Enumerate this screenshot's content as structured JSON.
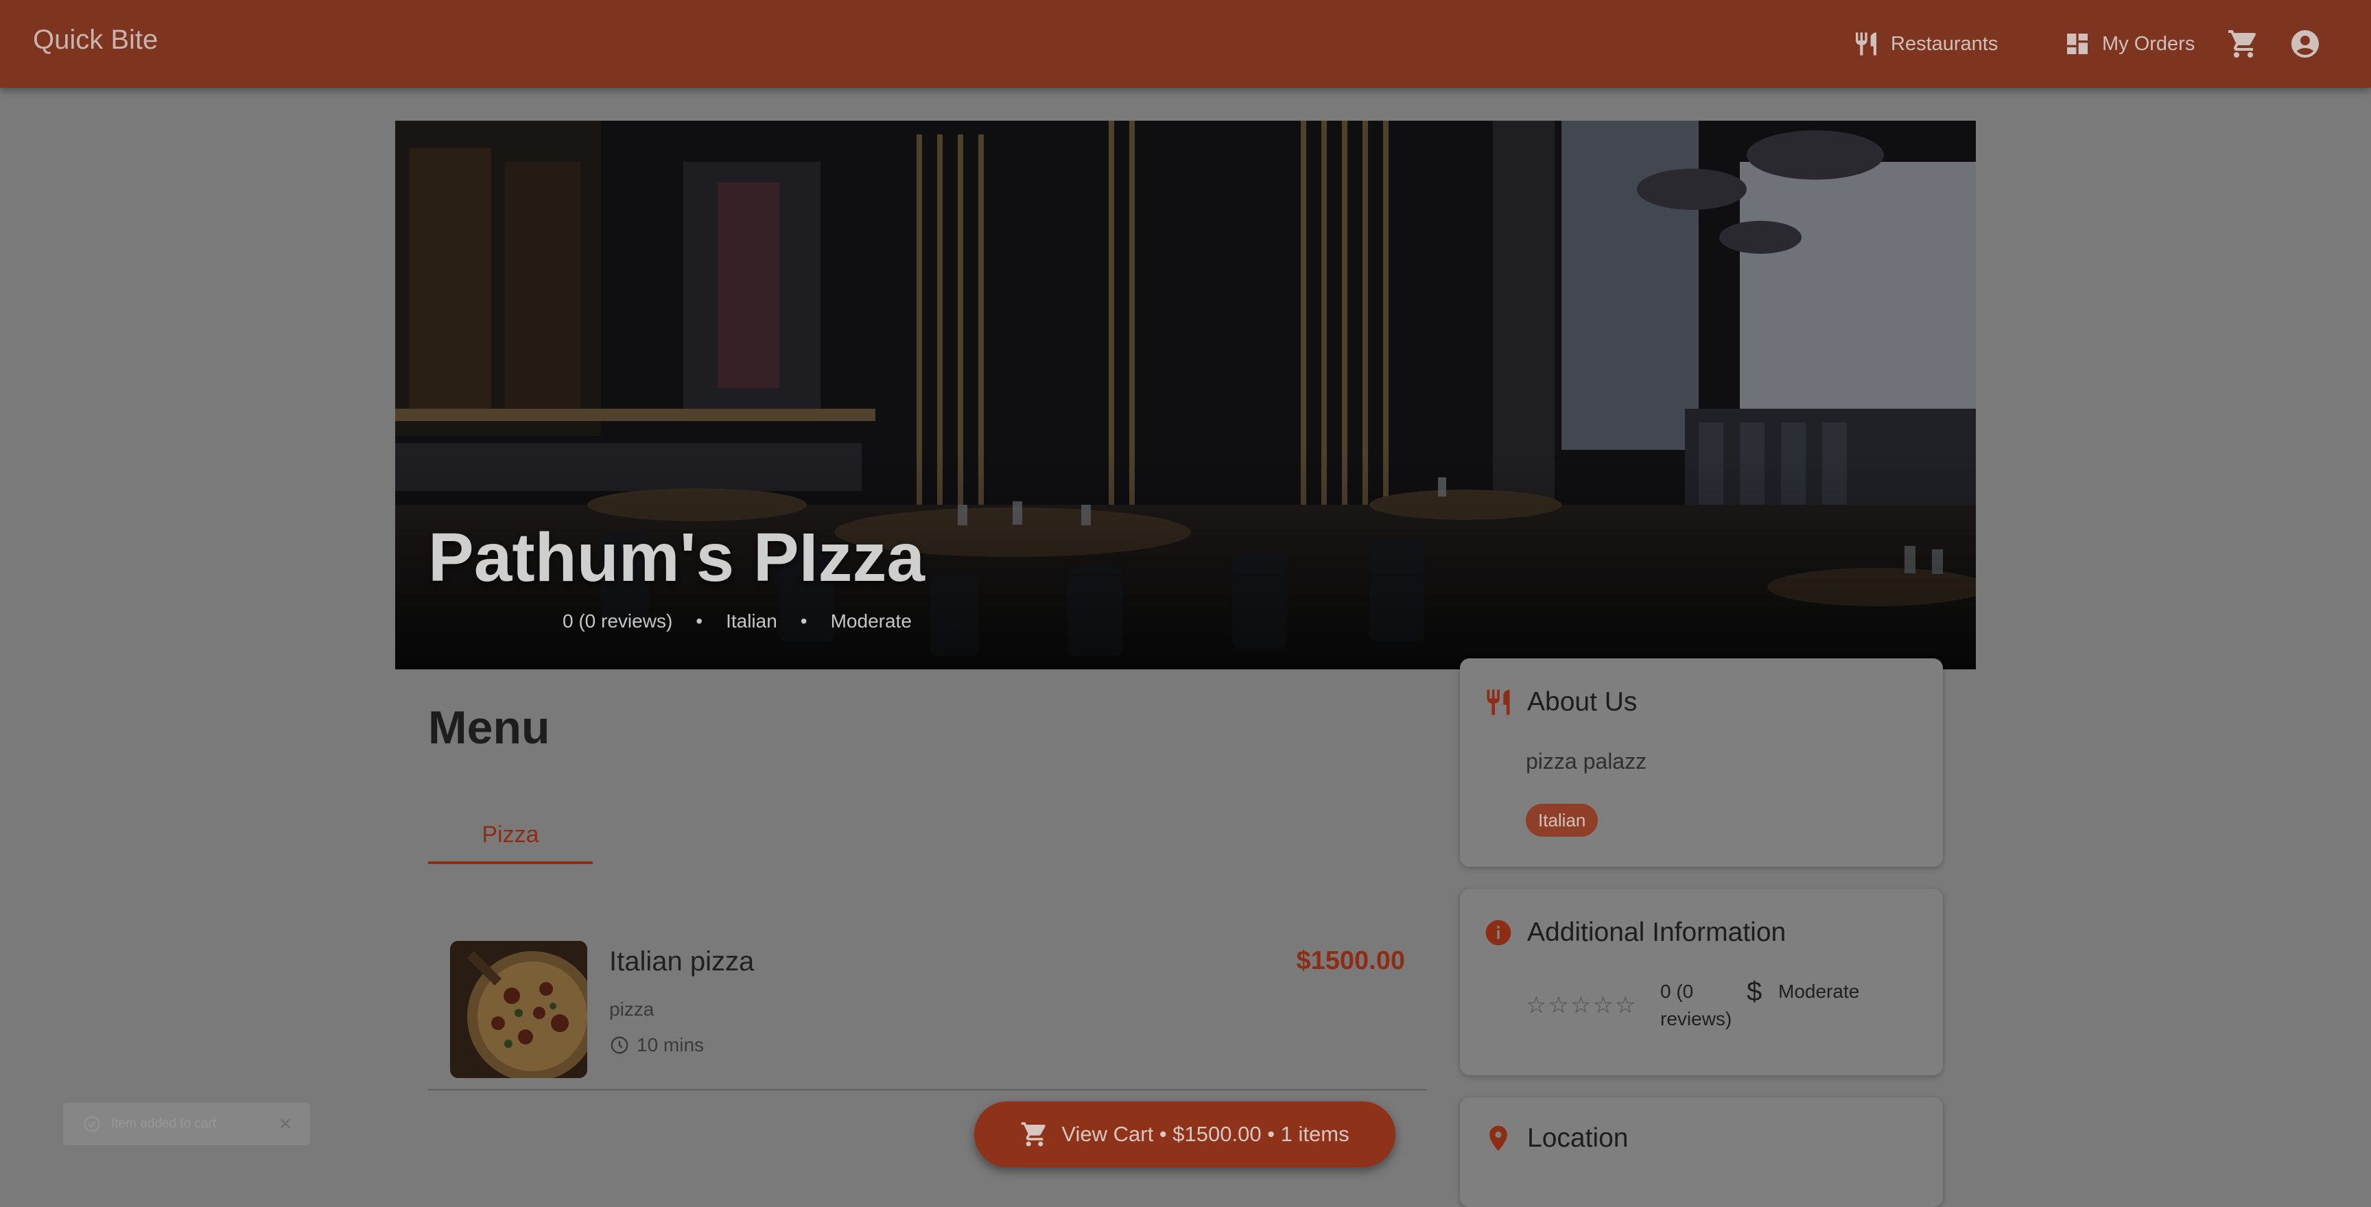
{
  "app": {
    "brand": "Quick Bite"
  },
  "nav": {
    "restaurants_label": "Restaurants",
    "orders_label": "My Orders",
    "cart_icon": "cart-icon",
    "account_icon": "account-circle-icon"
  },
  "hero": {
    "name": "Pathum's PIzza",
    "rating": "0 (0 reviews)",
    "separator": "•",
    "cuisine": "Italian",
    "price_level": "Moderate"
  },
  "menu": {
    "title": "Menu",
    "tabs": [
      {
        "label": "Pizza",
        "active": true
      }
    ],
    "items": [
      {
        "name": "Italian pizza",
        "description": "pizza",
        "prep_time": "10 mins",
        "price": "$1500.00"
      }
    ]
  },
  "about": {
    "title": "About Us",
    "text": "pizza palazz",
    "tag": "Italian"
  },
  "additional": {
    "title": "Additional Information",
    "stars": "☆☆☆☆☆",
    "rating_line1": "0 (0",
    "rating_line2": "reviews)",
    "currency_symbol": "$",
    "price_level": "Moderate"
  },
  "location": {
    "title": "Location"
  },
  "cart": {
    "label": "View Cart • $1500.00 • 1 items"
  },
  "snackbar": {
    "text": "Item added to cart",
    "close": "✕"
  },
  "colors": {
    "primary": "#8c2d14",
    "appbar": "#7e3520",
    "overlay_background": "#7a7a7a"
  }
}
